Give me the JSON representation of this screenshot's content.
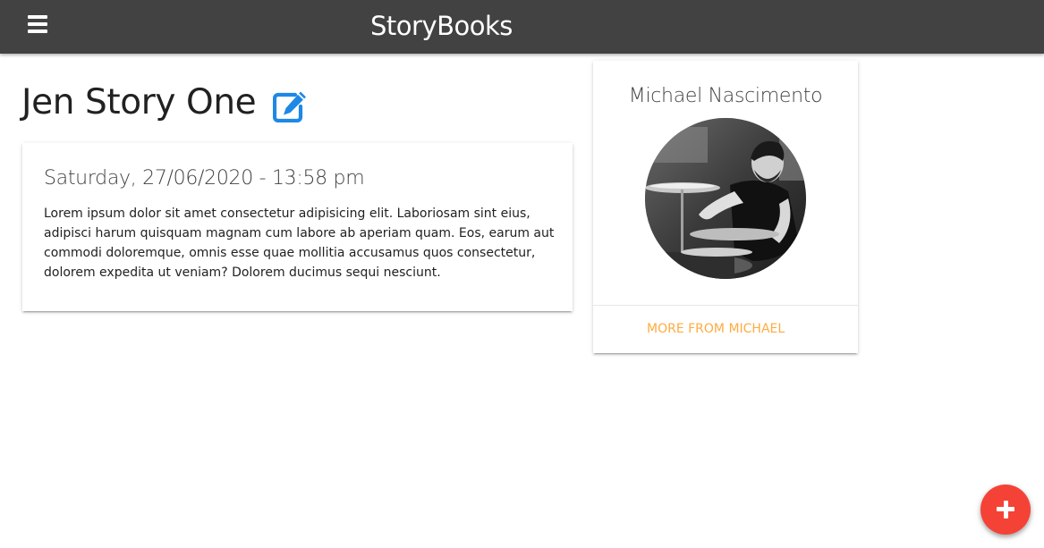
{
  "navbar": {
    "brand": "StoryBooks",
    "menu_icon": "hamburger-menu-icon",
    "background": "#424242"
  },
  "story": {
    "title": "Jen Story One",
    "edit_icon": "edit-pencil-square-icon",
    "edit_icon_color": "#1e88e5",
    "date": "Saturday, 27/06/2020 - 13:58 pm",
    "body": "Lorem ipsum dolor sit amet consectetur adipisicing elit. Laboriosam sint eius, adipisci harum quisquam magnam cum labore ab aperiam quam. Eos, earum aut commodi doloremque, omnis esse quae mollitia accusamus quos consectetur, dolorem expedita ut veniam? Dolorem ducimus sequi nesciunt."
  },
  "author": {
    "name": "Michael Nascimento",
    "avatar": "author-photo-drummer",
    "more_link": "MORE FROM MICHAEL",
    "link_color": "#ffab40"
  },
  "fab": {
    "icon": "plus-icon",
    "color": "#f44336"
  }
}
